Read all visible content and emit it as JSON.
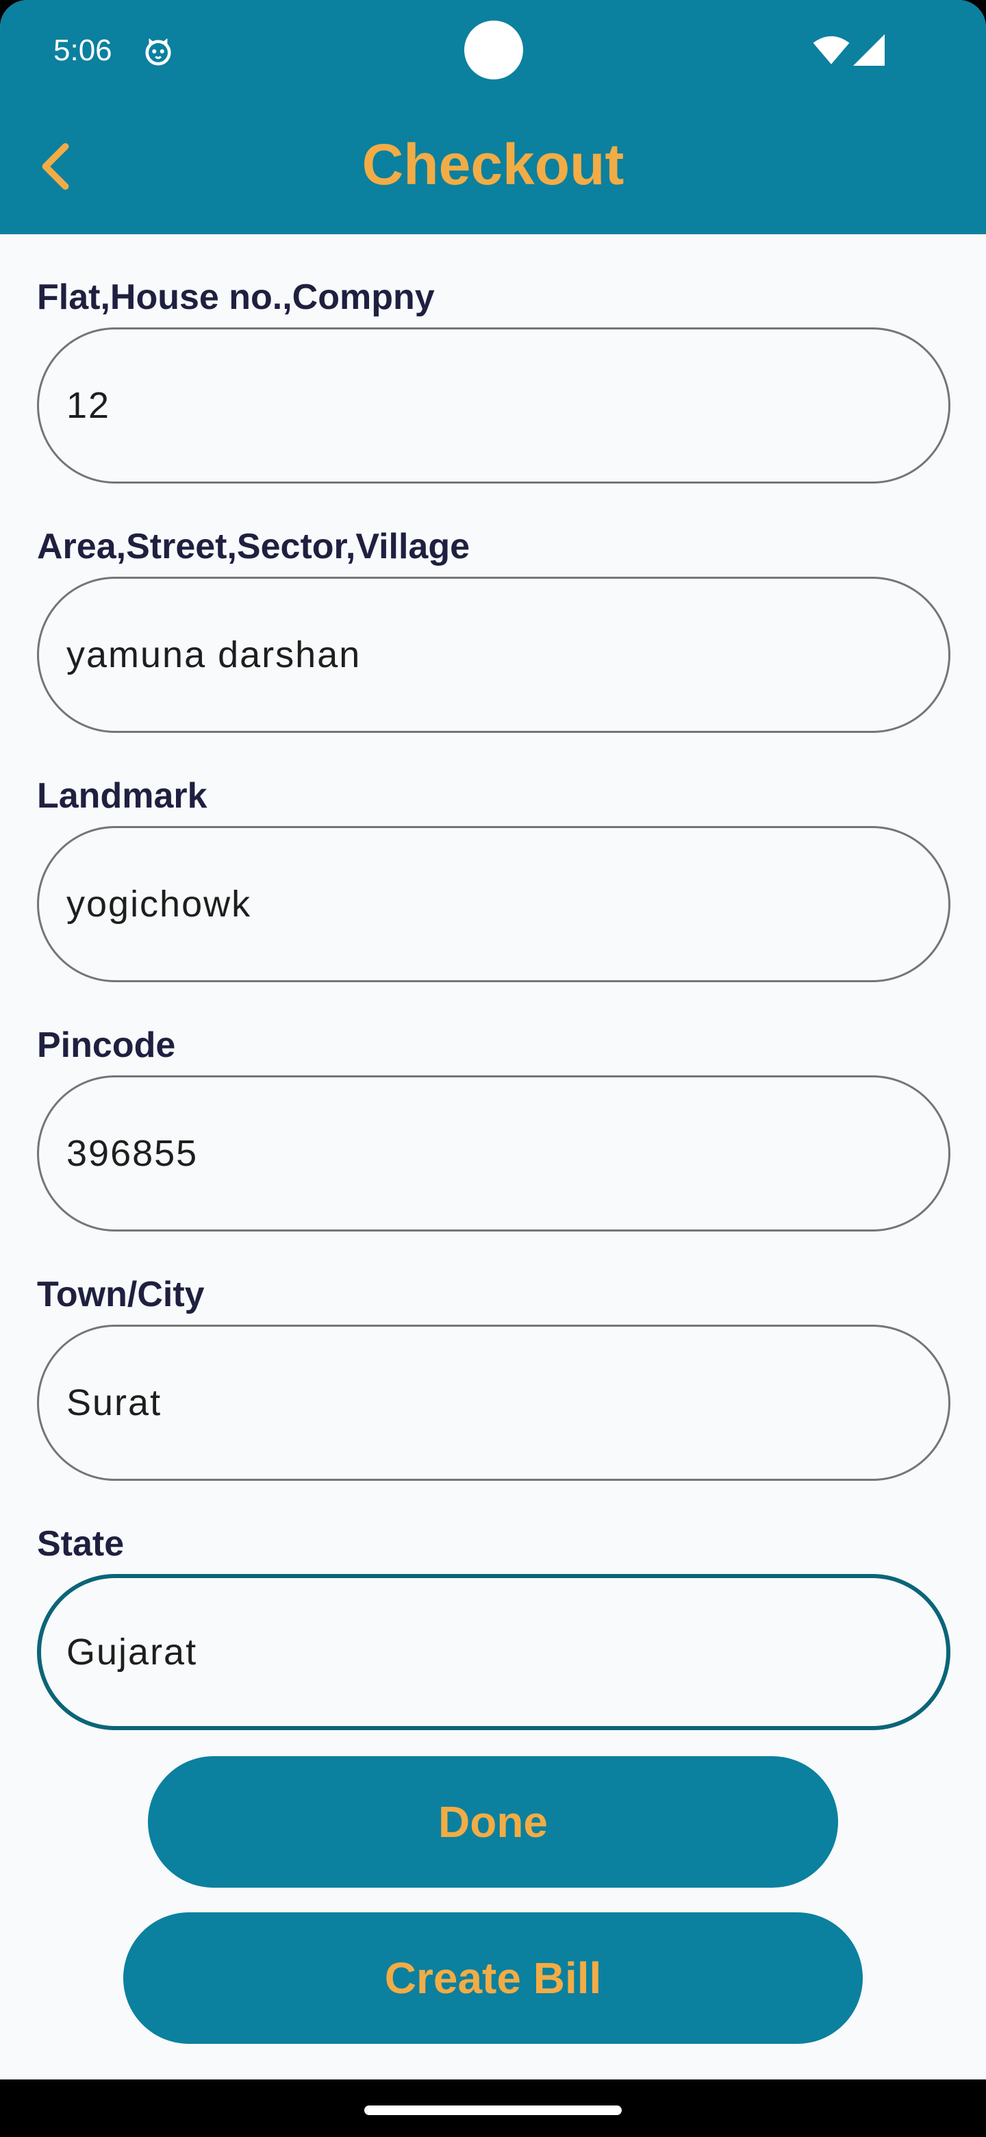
{
  "status_bar": {
    "time": "5:06",
    "icons": [
      "cat-icon",
      "wifi-icon",
      "signal-icon"
    ]
  },
  "header": {
    "title": "Checkout",
    "back_icon": "chevron-left-icon"
  },
  "colors": {
    "primary": "#0c809f",
    "accent": "#f2ac45",
    "label": "#1f2040",
    "focused_border": "#0b6478"
  },
  "form": {
    "fields": [
      {
        "label": "Flat,House no.,Compny",
        "value": "12"
      },
      {
        "label": "Area,Street,Sector,Village",
        "value": "yamuna darshan"
      },
      {
        "label": "Landmark",
        "value": "yogichowk"
      },
      {
        "label": "Pincode",
        "value": "396855"
      },
      {
        "label": "Town/City",
        "value": "Surat"
      },
      {
        "label": "State",
        "value": "Gujarat"
      }
    ]
  },
  "buttons": {
    "done": "Done",
    "create_bill": "Create Bill"
  }
}
